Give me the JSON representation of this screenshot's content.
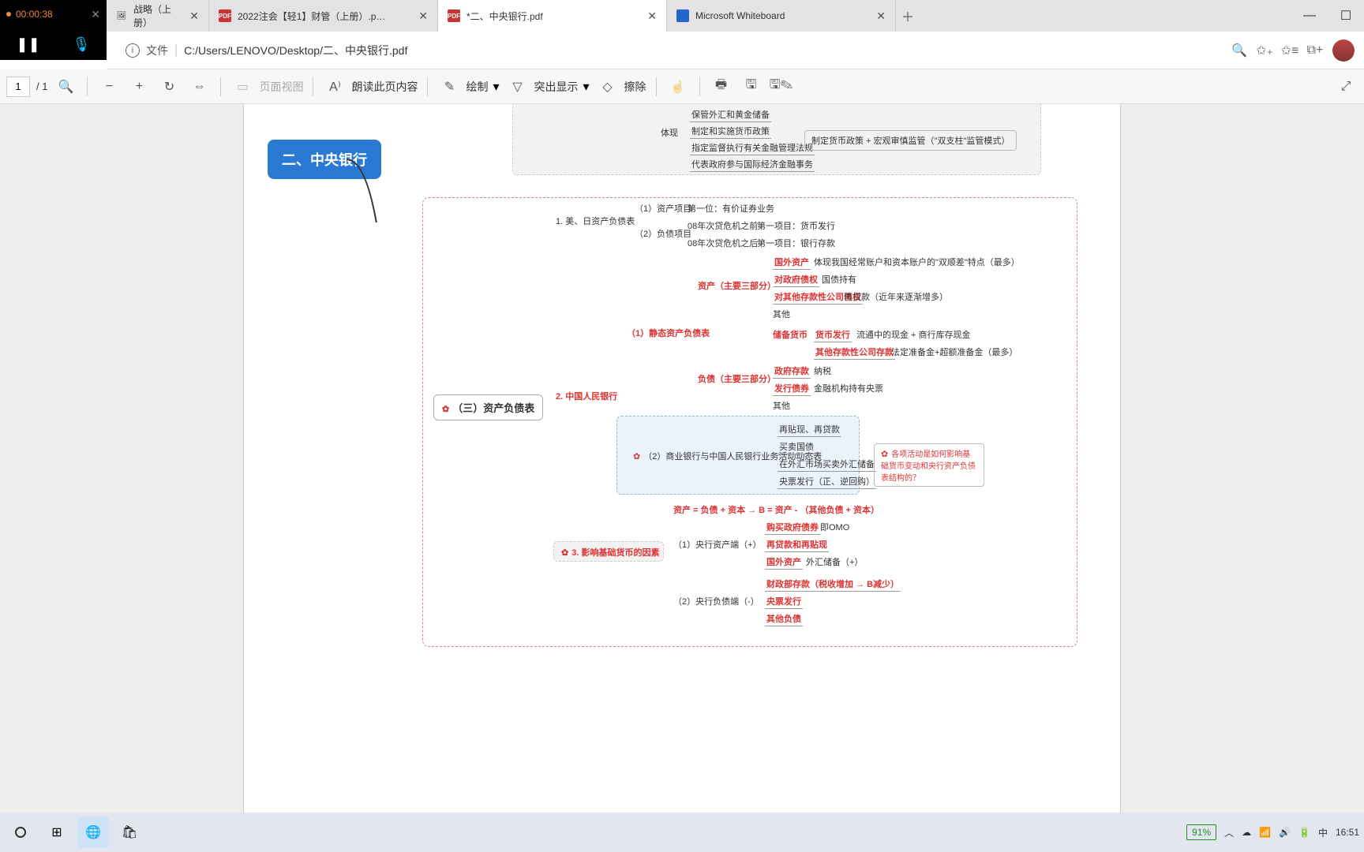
{
  "rec": {
    "time": "00:00:38"
  },
  "tabs": [
    {
      "title": "战略（上册）",
      "fav": "img"
    },
    {
      "title": "2022注会【轻1】财管（上册）.p…",
      "fav": "pdf"
    },
    {
      "title": "*二、中央银行.pdf",
      "fav": "pdf",
      "active": true
    },
    {
      "title": "Microsoft Whiteboard",
      "fav": "wb"
    }
  ],
  "addr": {
    "file_label": "文件",
    "url": "C:/Users/LENOVO/Desktop/二、中央银行.pdf"
  },
  "pdfbar": {
    "page": "1",
    "total": "/ 1",
    "pageview": "页面视图",
    "read": "朗读此页内容",
    "draw": "绘制",
    "hilite": "突出显示",
    "erase": "擦除"
  },
  "root": "二、中央银行",
  "top": {
    "tx": "体现",
    "r1": "保管外汇和黄金储备",
    "r2": "制定和实施货币政策",
    "r3": "指定监督执行有关金融管理法规",
    "r4": "代表政府参与国际经济金融事务",
    "note": "制定货币政策 + 宏观审慎监管（\"双支柱\"监管模式）"
  },
  "main": {
    "title": "（三）资产负债表",
    "s1": {
      "title": "1. 美、日资产负债表",
      "a": "（1）资产项目",
      "a1": "第一位：有价证券业务",
      "b": "（2）负债项目",
      "b1": "08年次贷危机之前",
      "b1v": "第一项目：货币发行",
      "b2": "08年次贷危机之后",
      "b2v": "第一项目：银行存款"
    },
    "s2": {
      "title": "2. 中国人民银行",
      "a": "（1）静态资产负债表",
      "assets": "资产（主要三部分）",
      "as1": "国外资产",
      "as1v": "体现我国经常账户和资本账户的\"双顺差\"特点（最多）",
      "as2": "对政府债权",
      "as2v": "国债持有",
      "as3": "对其他存款性公司债权",
      "as3v": "再贷款（近年来逐渐增多）",
      "as4": "其他",
      "liab": "负债（主要三部分）",
      "rb": "储备货币",
      "li1": "货币发行",
      "li1v": "流通中的现金 + 商行库存现金",
      "li2": "其他存款性公司存款",
      "li2v": "法定准备金+超额准备金（最多）",
      "li3": "政府存款",
      "li3v": "纳税",
      "li4": "发行债券",
      "li4v": "金融机构持有央票",
      "li5": "其他",
      "b": "（2）商业银行与中国人民银行业务活动动态表",
      "bb1": "再贴现、再贷款",
      "bb2": "买卖国债",
      "bb3": "在外汇市场买卖外汇储备",
      "bb4": "央票发行（正、逆回购）",
      "note": "各项活动是如何影响基础货币变动和央行资产负债表结构的？"
    },
    "s3": {
      "title": "3. 影响基础货币的因素",
      "eq": "资产 = 负债 + 资本 → B = 资产 - （其他负债 + 资本）",
      "a": "（1）央行资产端（+）",
      "a1": "购买政府债券",
      "a1v": "即OMO",
      "a2": "再贷款和再贴现",
      "a3": "国外资产",
      "a3v": "外汇储备（+）",
      "b": "（2）央行负债端（-）",
      "b1": "财政部存款（税收增加 → B减少）",
      "b2": "央票发行",
      "b3": "其他负债"
    }
  },
  "tray": {
    "zoom": "91%",
    "ime": "中",
    "time": "16:51"
  }
}
